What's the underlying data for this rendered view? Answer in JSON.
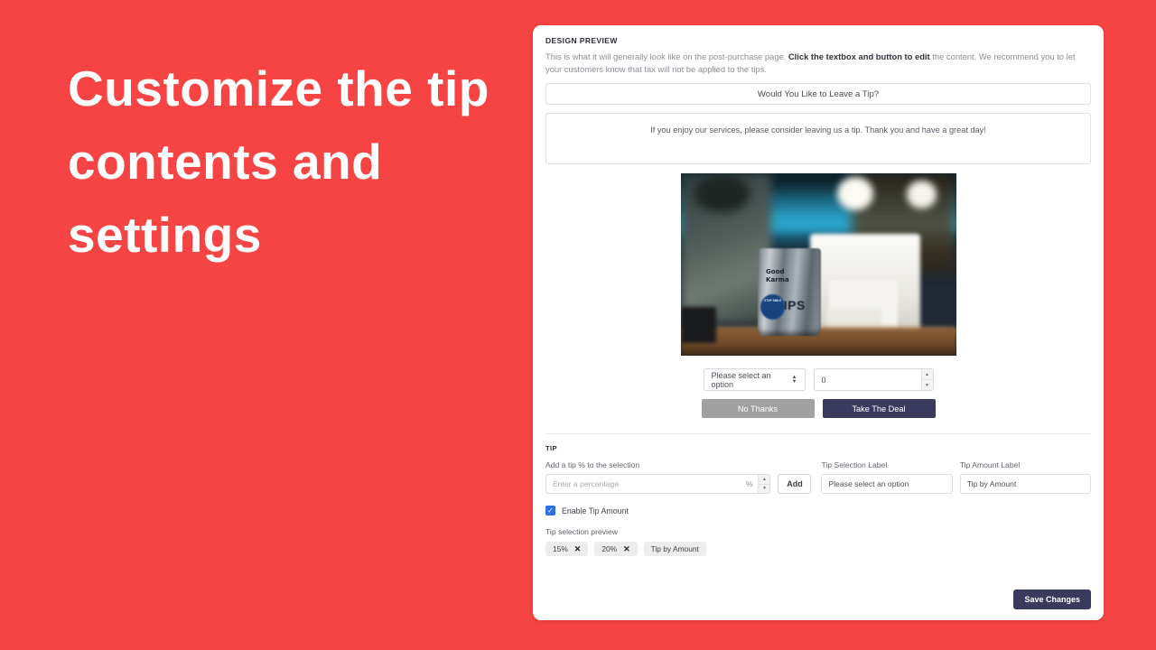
{
  "theme": {
    "background": "#f64444",
    "card_background": "#ffffff",
    "primary_button": "#3a3a5e",
    "secondary_button": "#a0a0a0",
    "checkbox_accent": "#2f6fe4"
  },
  "headline": "Customize the tip contents and settings",
  "card": {
    "preview": {
      "section_title": "DESIGN PREVIEW",
      "description_part1": "This is what it will generally look like on the post-purchase page. ",
      "description_bold": "Click the textbox and button to edit",
      "description_part2": " the content. We recommend you to let your customers know that tax will not be applied to the tips.",
      "title_textbox": "Would You Like to Leave a Tip?",
      "body_textbox": "If you enjoy our services, please consider leaving us a tip. Thank you and have a great day!",
      "image_alt": "tip-jar-on-coffee-shop-counter",
      "image_text": {
        "jar_line1": "Good",
        "jar_line2": "Karma",
        "jar_line3": "TIPS",
        "badge": "STOP SMILE"
      },
      "select_value": "Please select an option",
      "amount_value": "0",
      "decline_button": "No Thanks",
      "accept_button": "Take The Deal"
    },
    "tip": {
      "section_title": "TIP",
      "percent_field_label": "Add a tip % to the selection",
      "percent_placeholder": "Enter a percentage",
      "percent_symbol": "%",
      "add_button": "Add",
      "tip_selection_label_title": "Tip Selection Label",
      "tip_selection_label_value": "Please select an option",
      "tip_amount_label_title": "Tip Amount Label",
      "tip_amount_label_value": "Tip by Amount",
      "enable_tip_amount_label": "Enable Tip Amount",
      "enable_tip_amount_checked": "✓",
      "preview_label": "Tip selection preview",
      "chips": [
        {
          "label": "15%",
          "remove": "✕",
          "removable": true
        },
        {
          "label": "20%",
          "remove": "✕",
          "removable": true
        },
        {
          "label": "Tip by Amount",
          "remove": "",
          "removable": false
        }
      ]
    },
    "save_button": "Save Changes"
  }
}
